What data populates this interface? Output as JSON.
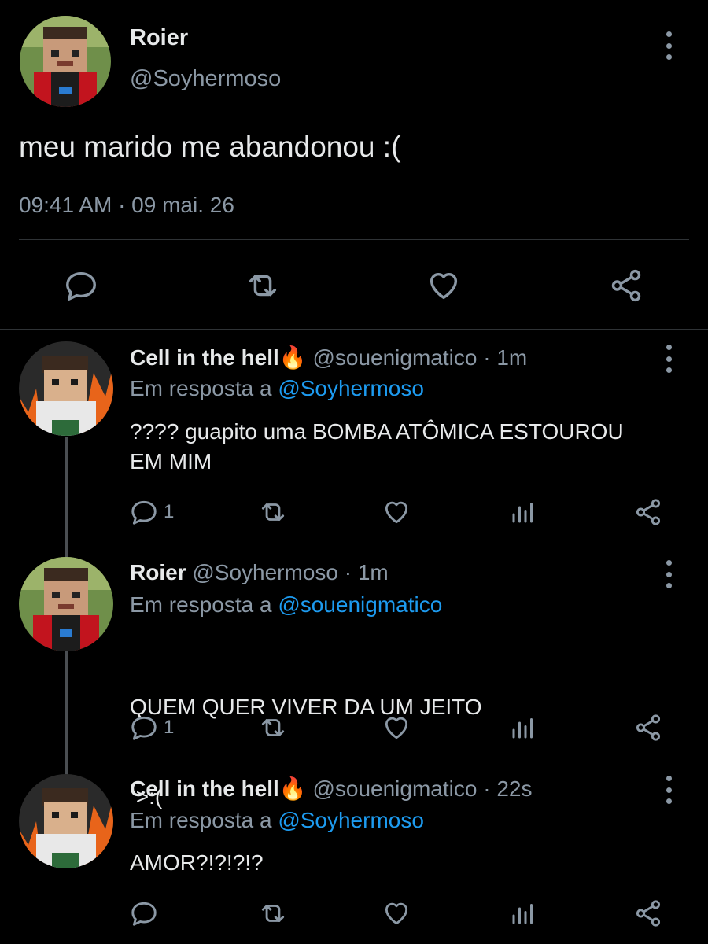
{
  "main_tweet": {
    "name": "Roier",
    "handle": "@Soyhermoso",
    "text": "meu marido me abandonou :(",
    "timestamp": "09:41 AM · 09 mai. 26",
    "actions": [
      "reply-icon",
      "retweet-icon",
      "like-icon",
      "share-icon"
    ]
  },
  "replies": [
    {
      "name": "Cell in the hell",
      "emoji": "🔥",
      "handle": "@souenigmatico",
      "time": "· 1m",
      "reply_prefix": "Em resposta a",
      "reply_to": "@Soyhermoso",
      "text_line1": "???? guapito uma BOMBA ATÔMICA ESTOUROU",
      "text_line2": "EM MIM",
      "reply_count": "1"
    },
    {
      "name": "Roier",
      "handle": "@Soyhermoso",
      "time": "· 1m",
      "reply_prefix": "Em resposta a",
      "reply_to": "@souenigmatico",
      "text_line1": "QUEM QUER VIVER DA UM JEITO",
      "text_line2": " >:(",
      "reply_count": "1"
    },
    {
      "name": "Cell in the hell",
      "emoji": "🔥",
      "handle": "@souenigmatico",
      "time": "· 22s",
      "reply_prefix": "Em resposta a",
      "reply_to": "@Soyhermoso",
      "text_line1": "AMOR?!?!?!?",
      "reply_count": ""
    }
  ],
  "colors": {
    "background": "#000000",
    "text": "#e7e9ea",
    "muted": "#8b98a5",
    "link": "#1d9bf0",
    "divider": "#2f3336"
  }
}
